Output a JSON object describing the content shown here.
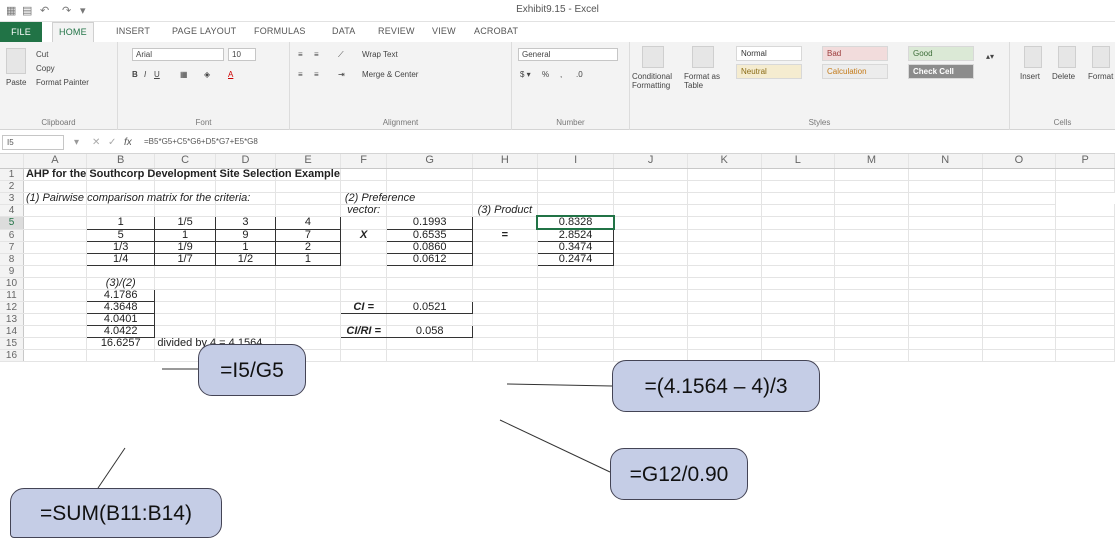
{
  "window": {
    "title": "Exhibit9.15 - Excel"
  },
  "tabs": [
    "FILE",
    "HOME",
    "INSERT",
    "PAGE LAYOUT",
    "FORMULAS",
    "DATA",
    "REVIEW",
    "VIEW",
    "ACROBAT"
  ],
  "ribbon": {
    "clipboard": {
      "paste": "Paste",
      "cut": "Cut",
      "copy": "Copy",
      "format_painter": "Format Painter",
      "label": "Clipboard"
    },
    "font": {
      "name": "Arial",
      "size": "10",
      "label": "Font"
    },
    "alignment": {
      "wrap": "Wrap Text",
      "merge": "Merge & Center",
      "label": "Alignment"
    },
    "number": {
      "format": "General",
      "label": "Number"
    },
    "styles": {
      "conditional": "Conditional Formatting",
      "format_as": "Format as Table",
      "normal": "Normal",
      "bad": "Bad",
      "good": "Good",
      "neutral": "Neutral",
      "calculation": "Calculation",
      "check": "Check Cell",
      "label": "Styles"
    },
    "cells": {
      "insert": "Insert",
      "delete": "Delete",
      "format": "Format",
      "label": "Cells"
    }
  },
  "formula_bar": {
    "name_box": "I5",
    "formula": "=B5*G5+C5*G6+D5*G7+E5*G8"
  },
  "columns": [
    "A",
    "B",
    "C",
    "D",
    "E",
    "F",
    "G",
    "H",
    "I",
    "J",
    "K",
    "L",
    "M",
    "N",
    "O",
    "P"
  ],
  "rows": [
    "1",
    "2",
    "3",
    "4",
    "5",
    "6",
    "7",
    "8",
    "9",
    "10",
    "11",
    "12",
    "13",
    "14",
    "15",
    "16"
  ],
  "sheet": {
    "a1": "AHP for the Southcorp Development Site Selection Example",
    "a3": "(1) Pairwise comparison matrix for the criteria:",
    "g3": "(2) Preference",
    "g4": "vector:",
    "i4": "(3) Product",
    "matrix": [
      [
        "1",
        "1/5",
        "3",
        "4"
      ],
      [
        "5",
        "1",
        "9",
        "7"
      ],
      [
        "1/3",
        "1/9",
        "1",
        "2"
      ],
      [
        "1/4",
        "1/7",
        "1/2",
        "1"
      ]
    ],
    "vector": [
      "0.1993",
      "0.6535",
      "0.0860",
      "0.0612"
    ],
    "product": [
      "0.8328",
      "2.8524",
      "0.3474",
      "0.2474"
    ],
    "times": "X",
    "equals": "=",
    "b10": "(3)/(2)",
    "ratios": [
      "4.1786",
      "4.3648",
      "4.0401",
      "4.0422"
    ],
    "b15": "16.6257",
    "c15": "divided by 4 = 4.1564",
    "ci_label": "CI =",
    "ci_value": "0.0521",
    "cri_label": "CI/RI =",
    "cri_value": "0.058"
  },
  "callouts": {
    "i5g5": "=I5/G5",
    "ci": "=(4.1564 – 4)/3",
    "cri": "=G12/0.90",
    "sum": "=SUM(B11:B14)"
  }
}
